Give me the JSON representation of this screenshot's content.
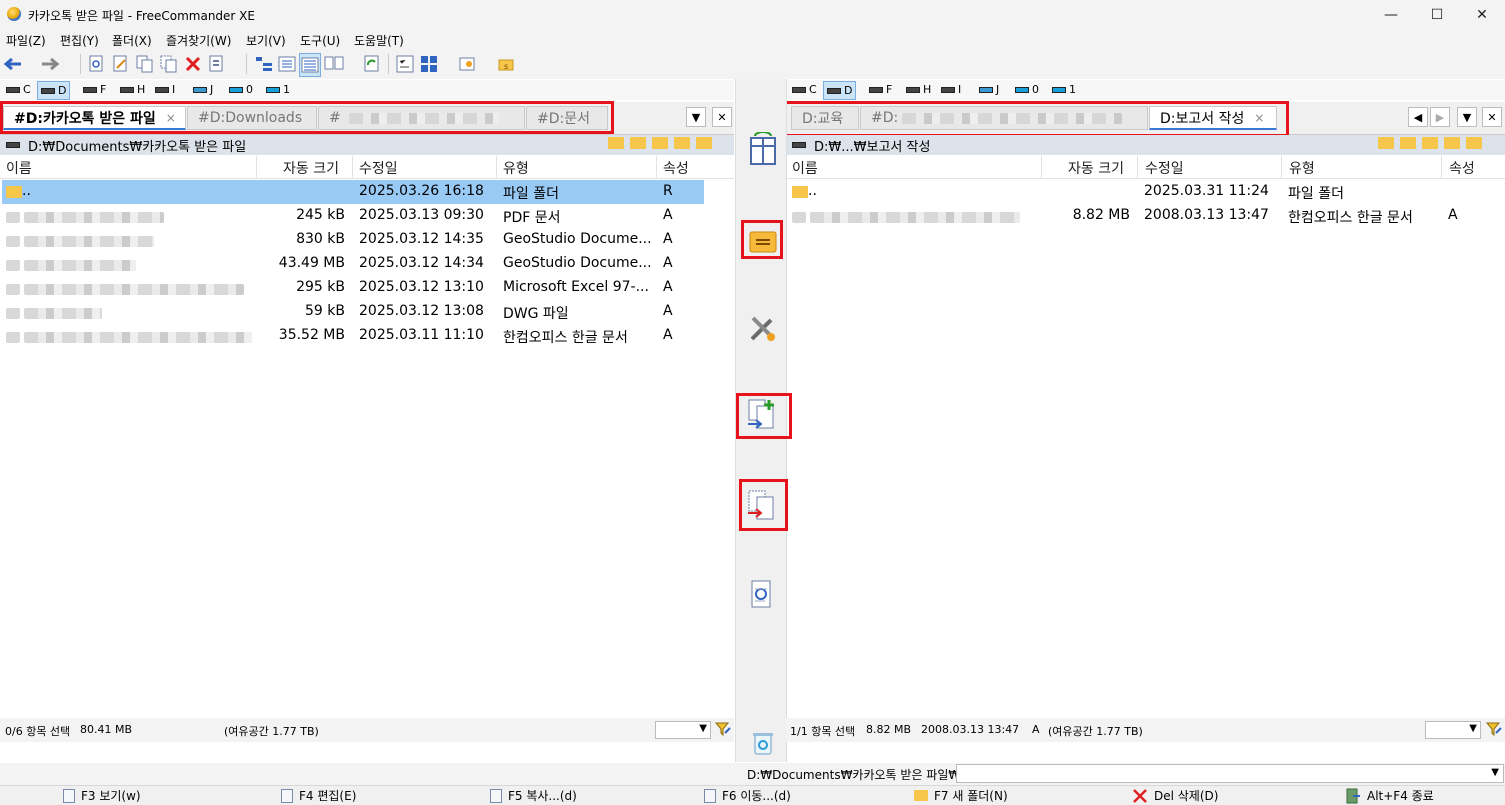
{
  "window": {
    "title": "카카오톡 받은 파일 - FreeCommander XE"
  },
  "menu": [
    "파일(Z)",
    "편집(Y)",
    "폴더(X)",
    "즐겨찾기(W)",
    "보기(V)",
    "도구(U)",
    "도움말(T)"
  ],
  "left": {
    "drives": [
      {
        "label": "C"
      },
      {
        "label": "D",
        "active": true
      },
      {
        "label": "F"
      },
      {
        "label": "H"
      },
      {
        "label": "I"
      },
      {
        "label": "J"
      },
      {
        "label": "0"
      },
      {
        "label": "1"
      }
    ],
    "tabs": [
      {
        "label": "#D:카카오톡 받은 파일",
        "active": true,
        "close": "×"
      },
      {
        "label": "#D:Downloads"
      },
      {
        "label": "#"
      },
      {
        "label": "#D:문서"
      }
    ],
    "path": "D:₩Documents₩카카오톡 받은 파일",
    "columns": {
      "name": "이름",
      "size": "자동 크기",
      "date": "수정일",
      "type": "유형",
      "attr": "속성"
    },
    "rows": [
      {
        "name": "..",
        "size": "",
        "date": "2025.03.26 16:18",
        "type": "파일 폴더",
        "attr": "R",
        "selected": true,
        "folder": true
      },
      {
        "name": "",
        "size": "245 kB",
        "date": "2025.03.13 09:30",
        "type": "PDF 문서",
        "attr": "A"
      },
      {
        "name": "",
        "size": "830 kB",
        "date": "2025.03.12 14:35",
        "type": "GeoStudio Docume...",
        "attr": "A"
      },
      {
        "name": "",
        "size": "43.49 MB",
        "date": "2025.03.12 14:34",
        "type": "GeoStudio Docume...",
        "attr": "A"
      },
      {
        "name": "",
        "size": "295 kB",
        "date": "2025.03.12 13:10",
        "type": "Microsoft Excel 97-...",
        "attr": "A"
      },
      {
        "name": "",
        "size": "59 kB",
        "date": "2025.03.12 13:08",
        "type": "DWG 파일",
        "attr": "A"
      },
      {
        "name": "",
        "size": "35.52 MB",
        "date": "2025.03.11 11:10",
        "type": "한컴오피스 한글 문서",
        "attr": "A"
      }
    ],
    "status": {
      "selection": "0/6 항목 선택",
      "size": "80.41 MB",
      "free": "(여유공간 1.77 TB)"
    }
  },
  "right": {
    "drives": [
      {
        "label": "C"
      },
      {
        "label": "D",
        "active": true
      },
      {
        "label": "F"
      },
      {
        "label": "H"
      },
      {
        "label": "I"
      },
      {
        "label": "J"
      },
      {
        "label": "0"
      },
      {
        "label": "1"
      }
    ],
    "tabs": [
      {
        "label": "D:교육"
      },
      {
        "label": "#D:"
      },
      {
        "label": "D:보고서 작성",
        "active": true,
        "close": "×"
      }
    ],
    "path": "D:₩...₩보고서 작성",
    "columns": {
      "name": "이름",
      "size": "자동 크기",
      "date": "수정일",
      "type": "유형",
      "attr": "속성"
    },
    "rows": [
      {
        "name": "..",
        "size": "",
        "date": "2025.03.31 11:24",
        "type": "파일 폴더",
        "attr": "",
        "folder": true
      },
      {
        "name": "",
        "size": "8.82 MB",
        "date": "2008.03.13 13:47",
        "type": "한컴오피스 한글 문서",
        "attr": "A"
      }
    ],
    "status": {
      "selection": "1/1 항목 선택",
      "size": "8.82 MB",
      "date": "2008.03.13 13:47",
      "attr": "A",
      "free": "(여유공간 1.77 TB)"
    }
  },
  "cmdline": {
    "path": "D:₩Documents₩카카오톡 받은 파일₩"
  },
  "fkeys": [
    "F3 보기(w)",
    "F4 편집(E)",
    "F5 복사...(d)",
    "F6 이동...(d)",
    "F7 새 폴더(N)",
    "Del 삭제(D)",
    "Alt+F4 종료"
  ],
  "colors": {
    "accent": "#3a7ad4",
    "selection": "#99c9f5",
    "highlight": "#e8131a"
  }
}
